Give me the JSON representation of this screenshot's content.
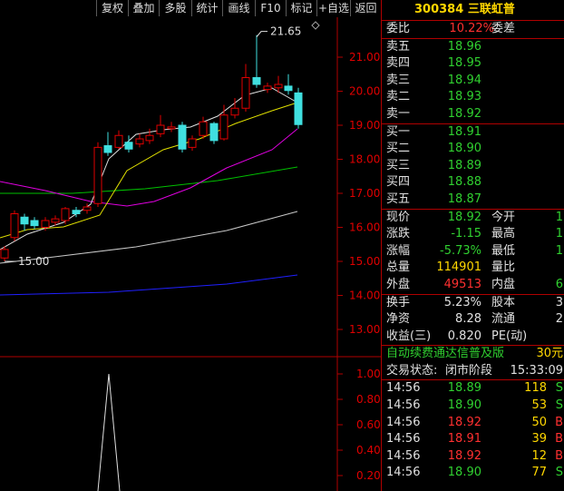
{
  "toolbar": {
    "buttons": [
      "复权",
      "叠加",
      "多股",
      "统计",
      "画线",
      "F10",
      "标记",
      "+自选",
      "返回"
    ]
  },
  "chart": {
    "price_axis": [
      "21.00",
      "20.00",
      "19.00",
      "18.00",
      "17.00",
      "16.00",
      "15.00",
      "14.00",
      "13.00"
    ],
    "high_label": "21.65",
    "low_label": "15.00",
    "indicator_axis": [
      "1.00",
      "0.80",
      "0.60",
      "0.40",
      "0.20"
    ],
    "colors": {
      "up": "#e00000",
      "down": "#40e0e0",
      "ma5": "#e0e0e0",
      "ma10": "#e0e000",
      "ma20": "#e000e0",
      "ma60": "#00c000",
      "ma120": "#c8c8c8",
      "ma250": "#2020ff"
    }
  },
  "quote": {
    "code": "300384",
    "name": "三联虹普",
    "weibi_label": "委比",
    "weibi_value": "10.22%",
    "weicha_label": "委差",
    "asks": [
      {
        "label": "卖五",
        "price": "18.96"
      },
      {
        "label": "卖四",
        "price": "18.95"
      },
      {
        "label": "卖三",
        "price": "18.94"
      },
      {
        "label": "卖二",
        "price": "18.93"
      },
      {
        "label": "卖一",
        "price": "18.92"
      }
    ],
    "bids": [
      {
        "label": "买一",
        "price": "18.91"
      },
      {
        "label": "买二",
        "price": "18.90"
      },
      {
        "label": "买三",
        "price": "18.89"
      },
      {
        "label": "买四",
        "price": "18.88"
      },
      {
        "label": "买五",
        "price": "18.87"
      }
    ],
    "stats": [
      {
        "l1": "现价",
        "v1": "18.92",
        "c1": "green",
        "l2": "今开",
        "v2": "1"
      },
      {
        "l1": "涨跌",
        "v1": "-1.15",
        "c1": "green",
        "l2": "最高",
        "v2": "1"
      },
      {
        "l1": "涨幅",
        "v1": "-5.73%",
        "c1": "green",
        "l2": "最低",
        "v2": "1"
      },
      {
        "l1": "总量",
        "v1": "114901",
        "c1": "yellow",
        "l2": "量比",
        "v2": ""
      },
      {
        "l1": "外盘",
        "v1": "49513",
        "c1": "red",
        "l2": "内盘",
        "v2": "6"
      }
    ],
    "stats2": [
      {
        "l1": "换手",
        "v1": "5.23%",
        "l2": "股本",
        "v2": "3"
      },
      {
        "l1": "净资",
        "v1": "8.28",
        "l2": "流通",
        "v2": "2"
      },
      {
        "l1": "收益(三)",
        "v1": "0.820",
        "l2": "PE(动)",
        "v2": ""
      }
    ],
    "ad_text": "自动续费通达信普及版",
    "ad_price": "30元",
    "status_label": "交易状态:",
    "status_value": "闭市阶段",
    "status_time": "15:33:09",
    "ticks": [
      {
        "time": "14:56",
        "price": "18.89",
        "vol": "118",
        "side": "S",
        "c": "green"
      },
      {
        "time": "14:56",
        "price": "18.90",
        "vol": "53",
        "side": "S",
        "c": "green"
      },
      {
        "time": "14:56",
        "price": "18.92",
        "vol": "50",
        "side": "B",
        "c": "red"
      },
      {
        "time": "14:56",
        "price": "18.91",
        "vol": "39",
        "side": "B",
        "c": "red"
      },
      {
        "time": "14:56",
        "price": "18.92",
        "vol": "12",
        "side": "B",
        "c": "red"
      },
      {
        "time": "14:56",
        "price": "18.90",
        "vol": "77",
        "side": "S",
        "c": "green"
      }
    ]
  }
}
